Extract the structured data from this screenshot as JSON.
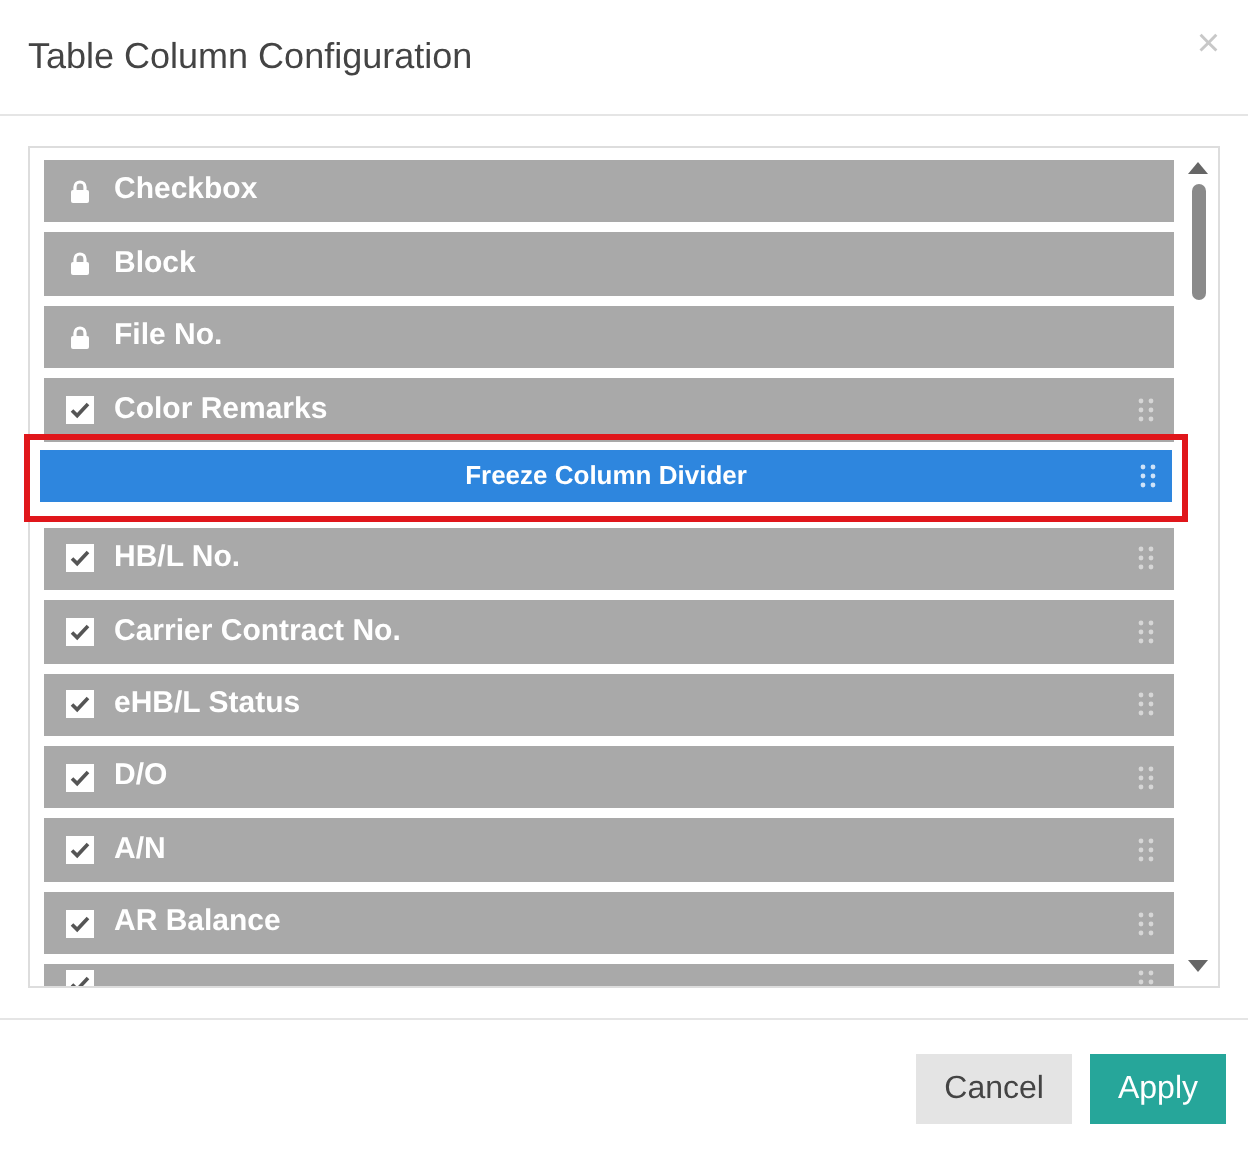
{
  "dialog": {
    "title": "Table Column Configuration",
    "close": "×"
  },
  "columns": [
    {
      "kind": "locked",
      "label": "Checkbox"
    },
    {
      "kind": "locked",
      "label": "Block"
    },
    {
      "kind": "locked",
      "label": "File No."
    },
    {
      "kind": "column",
      "label": "Color Remarks",
      "checked": true
    },
    {
      "kind": "divider",
      "label": "Freeze Column Divider",
      "highlighted": true
    },
    {
      "kind": "column",
      "label": "HB/L No.",
      "checked": true
    },
    {
      "kind": "column",
      "label": "Carrier Contract No.",
      "checked": true
    },
    {
      "kind": "column",
      "label": "eHB/L Status",
      "checked": true
    },
    {
      "kind": "column",
      "label": "D/O",
      "checked": true
    },
    {
      "kind": "column",
      "label": "A/N",
      "checked": true
    },
    {
      "kind": "column",
      "label": "AR Balance",
      "checked": true
    },
    {
      "kind": "cut",
      "checked": true
    }
  ],
  "buttons": [
    {
      "label": "Cancel",
      "kind": "secondary"
    },
    {
      "label": "Apply",
      "kind": "primary"
    }
  ]
}
